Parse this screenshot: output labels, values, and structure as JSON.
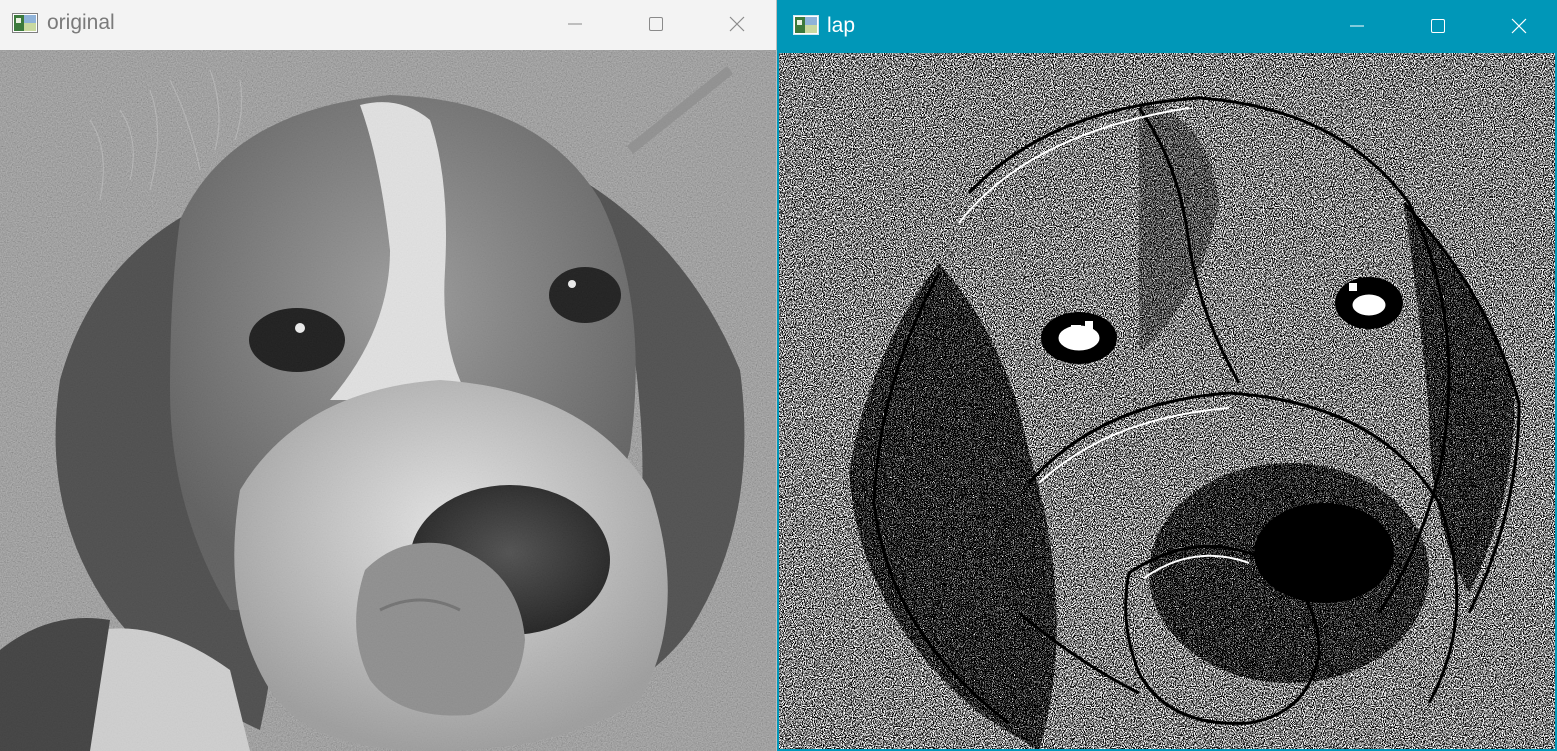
{
  "windows": [
    {
      "title": "original",
      "active": false,
      "controls": {
        "minimize_icon": "minimize-icon",
        "maximize_icon": "maximize-icon",
        "close_icon": "close-icon"
      },
      "content": "grayscale-photo-of-beagle-puppy"
    },
    {
      "title": "lap",
      "active": true,
      "accent_color": "#0097b8",
      "controls": {
        "minimize_icon": "minimize-icon",
        "maximize_icon": "maximize-icon",
        "close_icon": "close-icon"
      },
      "content": "laplacian-edge-image-of-beagle-puppy"
    }
  ]
}
